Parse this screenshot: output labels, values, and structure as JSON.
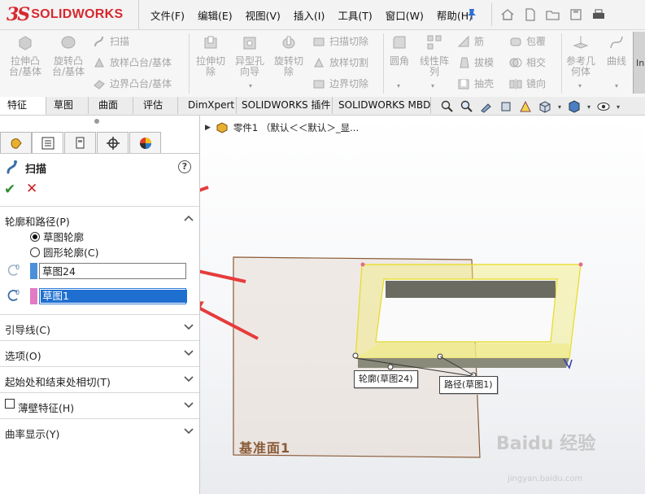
{
  "app": {
    "logo_prefix": "3S",
    "logo_text": "SOLIDWORKS"
  },
  "menu": [
    "文件(F)",
    "编辑(E)",
    "视图(V)",
    "插入(I)",
    "工具(T)",
    "窗口(W)",
    "帮助(H)"
  ],
  "commands": {
    "extrude_boss": [
      "拉伸凸",
      "台/基体"
    ],
    "revolve_boss": [
      "旋转凸",
      "台/基体"
    ],
    "sweep": "扫描",
    "loft_boss": "放样凸台/基体",
    "boundary_boss": "边界凸台/基体",
    "extrude_cut": [
      "拉伸切",
      "除"
    ],
    "hole_wizard": [
      "异型孔",
      "向导"
    ],
    "revolve_cut": [
      "旋转切",
      "除"
    ],
    "sweep_cut": "扫描切除",
    "loft_cut": "放样切割",
    "boundary_cut": "边界切除",
    "fillet": "圆角",
    "linear_pattern": [
      "线性阵",
      "列"
    ],
    "rib": "筋",
    "draft": "拔模",
    "shell": "抽壳",
    "wrap": "包覆",
    "intersect": "相交",
    "mirror": "镜向",
    "ref_geometry": [
      "参考几",
      "何体"
    ],
    "curves": "曲线",
    "instant3d": "In"
  },
  "tabs": [
    "特征",
    "草图",
    "曲面",
    "评估",
    "DimXpert",
    "SOLIDWORKS 插件",
    "SOLIDWORKS MBD"
  ],
  "active_tab": 0,
  "feature_tree": {
    "item": "零件1 （默认＜＜默认＞_显..."
  },
  "property_manager": {
    "title": "扫描",
    "help": "?",
    "ok": "✔",
    "cancel": "✕",
    "section_profile_path": "轮廓和路径(P)",
    "radio_sketch_profile": "草图轮廓",
    "radio_circle_profile": "圆形轮廓(C)",
    "radio_selected": "sketch_profile",
    "profile_value": "草图24",
    "path_value": "草图1",
    "profile_color": "#4a90d9",
    "path_color": "#e27bc4",
    "section_guides": "引导线(C)",
    "section_options": "选项(O)",
    "section_tangency": "起始处和结束处相切(T)",
    "section_thin": "薄壁特征(H)",
    "section_curvature": "曲率显示(Y)"
  },
  "graphics": {
    "callout_profile": "轮廓(草图24)",
    "callout_path": "路径(草图1)",
    "plane_label": "基准面1",
    "sweep_color": "#f2ec7a",
    "edge_color": "#e6dc1e",
    "plane_edge_color": "#8a5a36",
    "arrow_color": "#e63c3c"
  },
  "watermark": {
    "main": "Baidu 经验",
    "sub": "jingyan.baidu.com"
  }
}
